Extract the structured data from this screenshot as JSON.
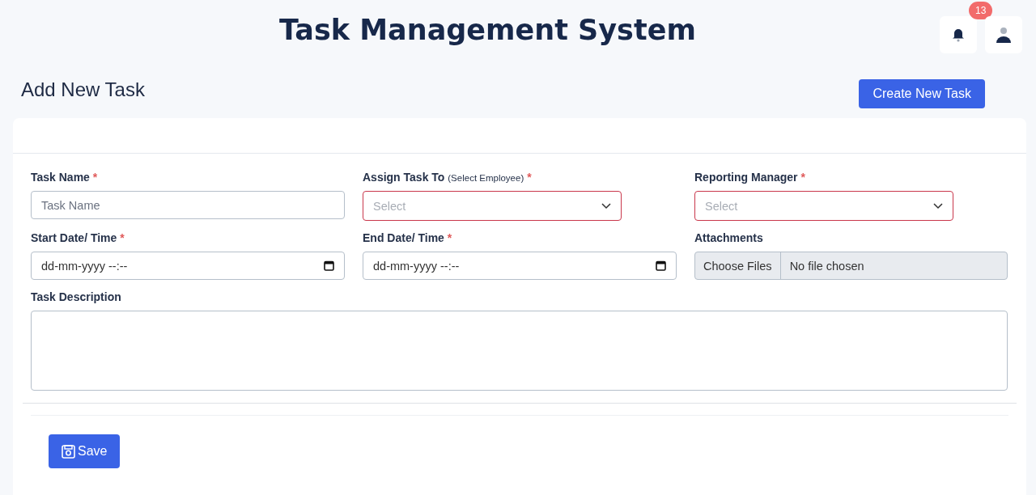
{
  "header": {
    "title": "Task Management System",
    "notification_count": "13"
  },
  "page": {
    "title": "Add New Task",
    "create_button": "Create New Task"
  },
  "form": {
    "fields": [
      {
        "kind": "text",
        "label": "Task Name",
        "required_mark": "*",
        "placeholder": "Task Name",
        "invalid": false
      },
      {
        "kind": "select",
        "label": "Assign Task To",
        "hint": "(Select Employee)",
        "required_mark": "*",
        "placeholder": "Select",
        "invalid": true
      },
      {
        "kind": "select",
        "label": "Reporting Manager",
        "required_mark": "*",
        "placeholder": "Select",
        "invalid": true
      },
      {
        "kind": "datetime",
        "label": "Start Date/ Time",
        "required_mark": "*",
        "value": "dd-mm-yyyy --:--",
        "invalid": false
      },
      {
        "kind": "datetime",
        "label": "End Date/ Time",
        "required_mark": "*",
        "value": "dd-mm-yyyy --:--",
        "invalid": false
      },
      {
        "kind": "file",
        "label": "Attachments",
        "button": "Choose Files",
        "value": "No file chosen",
        "invalid": false
      },
      {
        "kind": "textarea",
        "label": "Task Description",
        "invalid": false
      }
    ],
    "save_button": "Save"
  }
}
